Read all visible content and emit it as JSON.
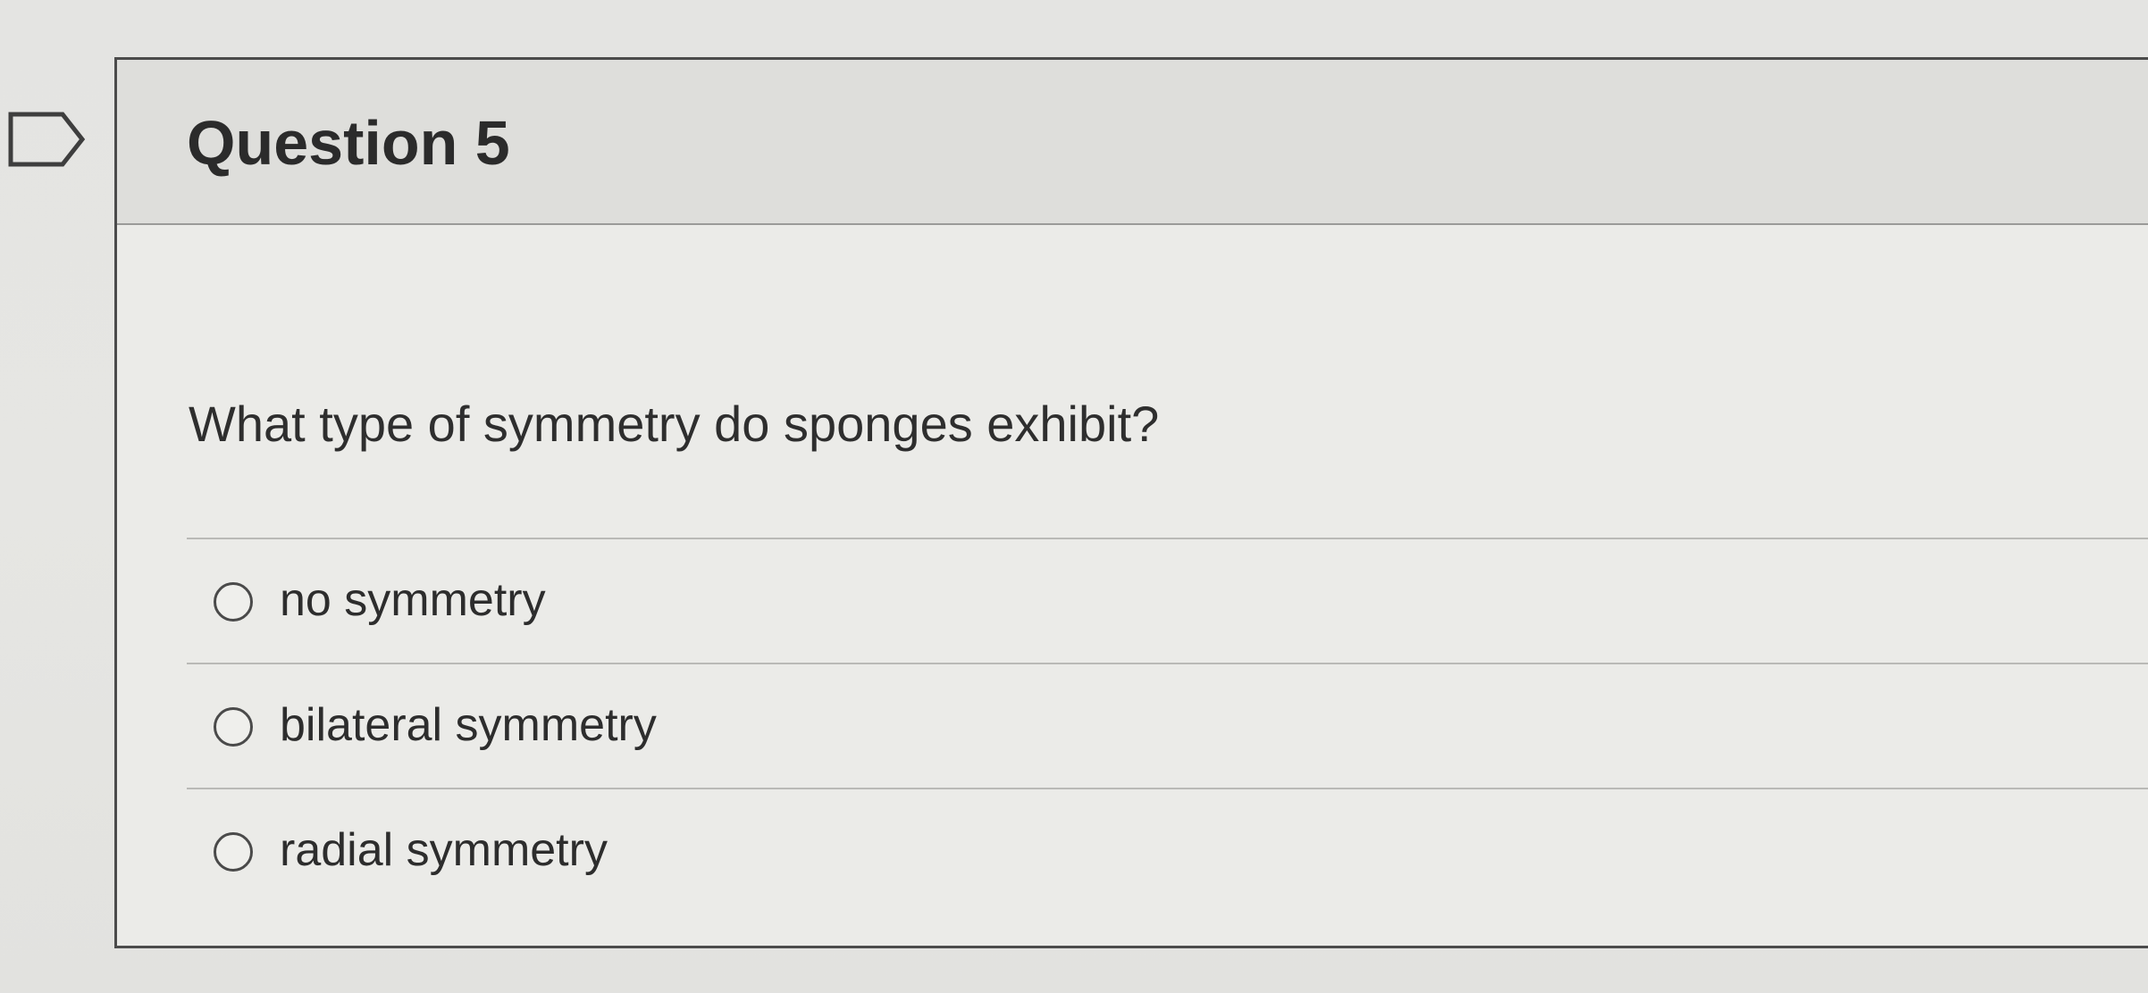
{
  "flag": {
    "icon": "bookmark-flag-icon"
  },
  "question": {
    "title": "Question 5",
    "text": "What type of symmetry do sponges exhibit?",
    "options": [
      {
        "label": "no symmetry",
        "selected": false
      },
      {
        "label": "bilateral symmetry",
        "selected": false
      },
      {
        "label": "radial symmetry",
        "selected": false
      }
    ]
  },
  "colors": {
    "background": "#e4e4e2",
    "header_background": "#dededb",
    "border": "#4b4b4b",
    "text": "#2d2d2d",
    "separator": "#b9b9b6"
  }
}
